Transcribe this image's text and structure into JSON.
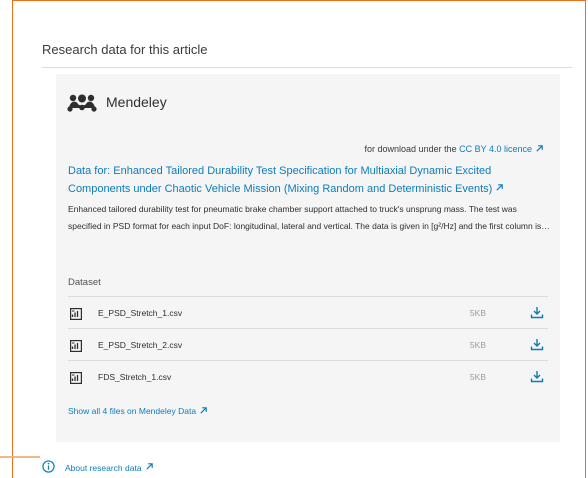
{
  "section": {
    "title": "Research data for this article"
  },
  "card": {
    "provider": "Mendeley",
    "licence_prefix": "for download under the",
    "licence_link": "CC BY 4.0 licence",
    "title": "Data for: Enhanced Tailored Durability Test Specification for Multiaxial Dynamic Excited Components under Chaotic Vehicle Mission (Mixing Random and Deterministic Events)",
    "description": "Enhanced tailored durability test for pneumatic brake chamber support attached to truck's unsprung mass. The test was specified in PSD format for each input DoF: longitudinal, lateral and vertical. The data is given in [g²/Hz] and the first column is…",
    "dataset_label": "Dataset",
    "files": [
      {
        "name": "E_PSD_Stretch_1.csv",
        "size": "5KB"
      },
      {
        "name": "E_PSD_Stretch_2.csv",
        "size": "5KB"
      },
      {
        "name": "FDS_Stretch_1.csv",
        "size": "5KB"
      }
    ],
    "show_all": "Show all 4 files on Mendeley Data"
  },
  "about": {
    "label": "About research data"
  },
  "colors": {
    "accent": "#0c7dbb",
    "frame": "#e9711c",
    "card_bg": "#f5f5f5"
  },
  "icons": {
    "logo": "mendeley-logo-icon",
    "external": "external-link-icon",
    "file": "spreadsheet-file-icon",
    "download": "download-icon",
    "info": "info-icon"
  }
}
